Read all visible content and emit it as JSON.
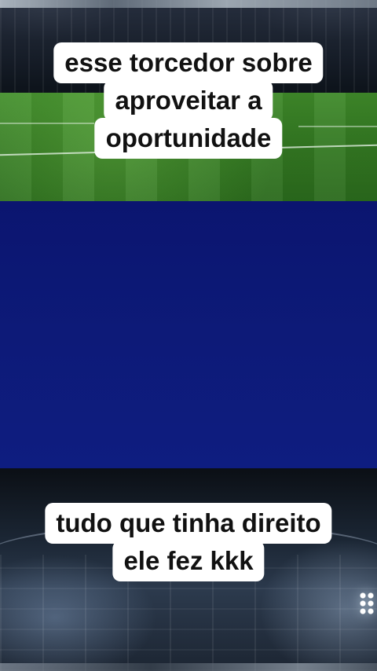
{
  "caption_top": {
    "lines": [
      "esse torcedor sobre",
      "aproveitar a",
      "oportunidade"
    ]
  },
  "caption_bottom": {
    "lines": [
      "tudo que tinha direito",
      "ele fez kkk"
    ]
  },
  "colors": {
    "video_panel": "#0d1a78",
    "caption_bg": "#ffffff",
    "caption_text": "#111111",
    "grass": "#357b23"
  }
}
